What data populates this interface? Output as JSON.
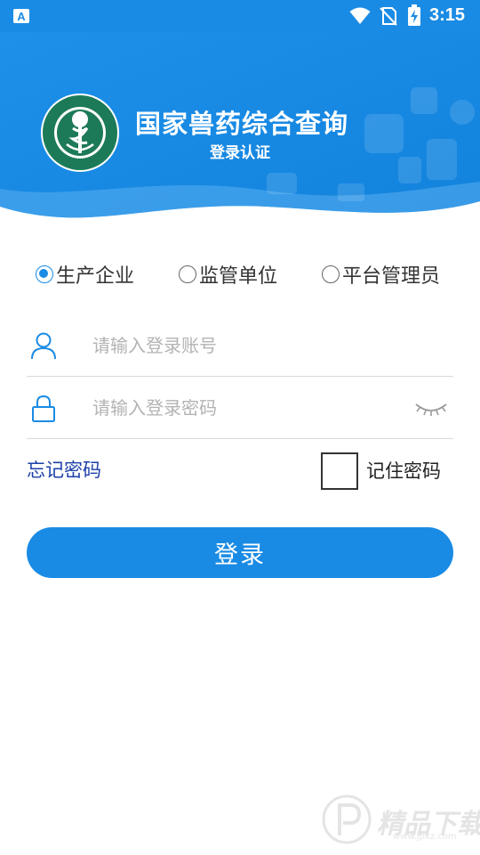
{
  "status_bar": {
    "time": "3:15",
    "icons": [
      "notification-a-icon",
      "wifi-icon",
      "no-sim-icon",
      "battery-charging-icon"
    ]
  },
  "header": {
    "title": "国家兽药综合查询",
    "subtitle": "登录认证",
    "logo": "institute-seal-logo"
  },
  "roles": {
    "selected": "生产企业",
    "options": [
      "生产企业",
      "监管单位",
      "平台管理员"
    ]
  },
  "account": {
    "placeholder": "请输入登录账号",
    "value": "",
    "icon": "user-icon"
  },
  "password": {
    "placeholder": "请输入登录密码",
    "value": "",
    "icon": "lock-icon",
    "toggle_icon": "eye-closed-icon"
  },
  "forgot_label": "忘记密码",
  "remember": {
    "label": "记住密码",
    "checked": false
  },
  "login_label": "登录",
  "colors": {
    "primary": "#1a8be4",
    "link": "#1c3fa8"
  }
}
